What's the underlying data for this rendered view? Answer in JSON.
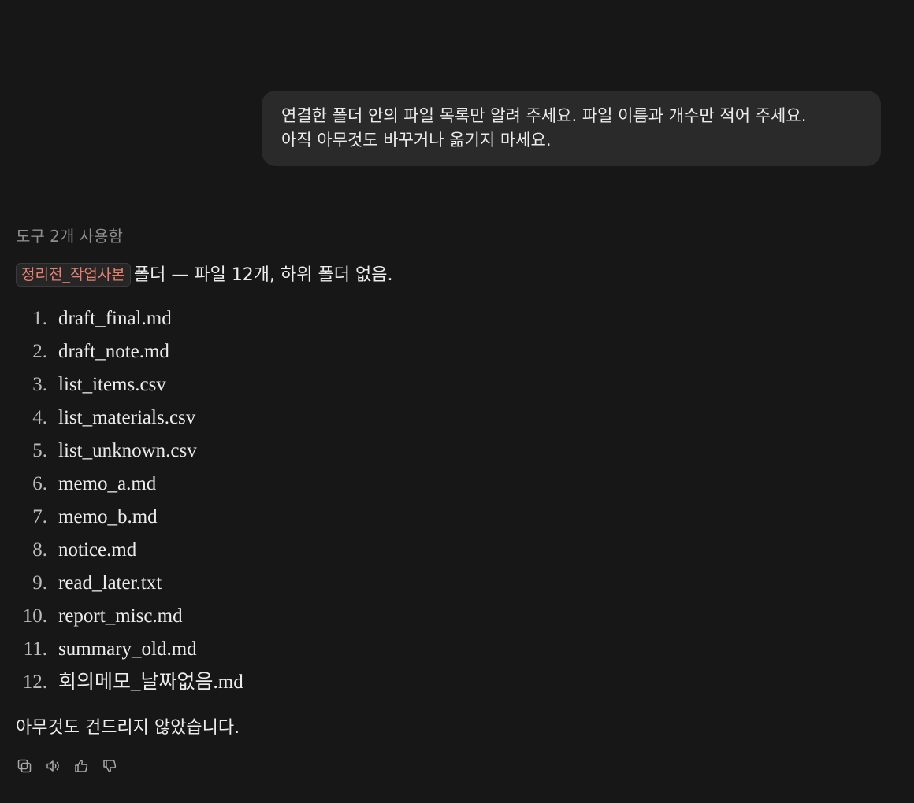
{
  "user_message": {
    "line1": "연결한 폴더 안의 파일 목록만 알려 주세요. 파일 이름과 개수만 적어 주세요.",
    "line2": "아직 아무것도 바꾸거나 옮기지 마세요."
  },
  "assistant": {
    "tools_used": "도구 2개 사용함",
    "folder_chip": "정리전_작업사본",
    "summary_text": "폴더 — 파일 12개, 하위 폴더 없음.",
    "files": [
      {
        "num": "1.",
        "name": "draft_final.md"
      },
      {
        "num": "2.",
        "name": "draft_note.md"
      },
      {
        "num": "3.",
        "name": "list_items.csv"
      },
      {
        "num": "4.",
        "name": "list_materials.csv"
      },
      {
        "num": "5.",
        "name": "list_unknown.csv"
      },
      {
        "num": "6.",
        "name": "memo_a.md"
      },
      {
        "num": "7.",
        "name": "memo_b.md"
      },
      {
        "num": "8.",
        "name": "notice.md"
      },
      {
        "num": "9.",
        "name": "read_later.txt"
      },
      {
        "num": "10.",
        "name": "report_misc.md"
      },
      {
        "num": "11.",
        "name": "summary_old.md"
      },
      {
        "num": "12.",
        "name": "회의메모_날짜없음.md"
      }
    ],
    "closing": "아무것도 건드리지 않았습니다.",
    "action_icons": [
      "copy-icon",
      "speaker-icon",
      "thumbs-up-icon",
      "thumbs-down-icon"
    ]
  },
  "colors": {
    "background": "#171717",
    "bubble": "#2a2a2a",
    "text": "#ececec",
    "muted": "#8e8e8e",
    "code_text": "#e8806f"
  }
}
